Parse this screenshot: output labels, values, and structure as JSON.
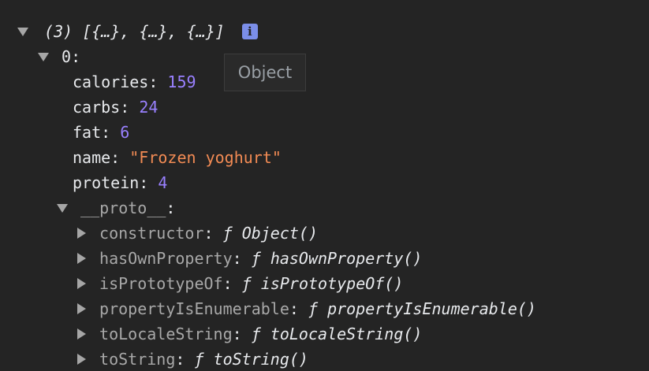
{
  "root": {
    "summary": "(3) [{…}, {…}, {…}]",
    "info_icon_glyph": "i"
  },
  "tooltip": {
    "text": "Object"
  },
  "item0": {
    "index_label": "0",
    "properties": [
      {
        "key": "calories",
        "value": "159"
      },
      {
        "key": "carbs",
        "value": "24"
      },
      {
        "key": "fat",
        "value": "6"
      },
      {
        "key": "name",
        "value": "\"Frozen yoghurt\""
      },
      {
        "key": "protein",
        "value": "4"
      }
    ],
    "proto_label": "__proto__",
    "proto_members": [
      {
        "key": "constructor",
        "fn_symbol": "ƒ",
        "fn": "Object()"
      },
      {
        "key": "hasOwnProperty",
        "fn_symbol": "ƒ",
        "fn": "hasOwnProperty()"
      },
      {
        "key": "isPrototypeOf",
        "fn_symbol": "ƒ",
        "fn": "isPrototypeOf()"
      },
      {
        "key": "propertyIsEnumerable",
        "fn_symbol": "ƒ",
        "fn": "propertyIsEnumerable()"
      },
      {
        "key": "toLocaleString",
        "fn_symbol": "ƒ",
        "fn": "toLocaleString()"
      },
      {
        "key": "toString",
        "fn_symbol": "ƒ",
        "fn": "toString()"
      }
    ]
  },
  "colors": {
    "background": "#242424",
    "number": "#9980ff",
    "string": "#f28b54",
    "dim_key": "#a8a8a8",
    "badge": "#7b8ee8"
  }
}
